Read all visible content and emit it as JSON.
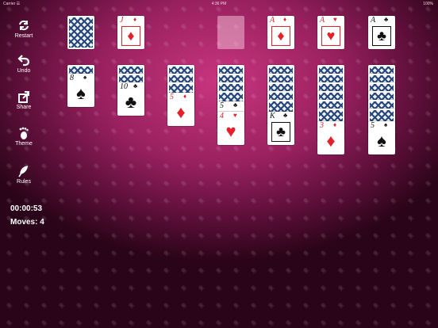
{
  "status": {
    "carrier": "Carrier ☰",
    "time": "4:36 PM",
    "battery": "100%"
  },
  "sidebar": {
    "restart": "Restart",
    "undo": "Undo",
    "share": "Share",
    "theme": "Theme",
    "rules": "Rules"
  },
  "game": {
    "timer": "00:00:53",
    "moves": "Moves: 4"
  },
  "cards": {
    "waste": {
      "rank": "J",
      "suit": "♦",
      "color": "red"
    },
    "foundation1": {
      "rank": "A",
      "suit": "♦",
      "color": "red"
    },
    "foundation2": {
      "rank": "A",
      "suit": "♥",
      "color": "red"
    },
    "foundation3": {
      "rank": "A",
      "suit": "♣",
      "color": "black"
    },
    "t1": {
      "rank": "8",
      "suit": "♠",
      "color": "black"
    },
    "t2": {
      "rank": "10",
      "suit": "♣",
      "color": "black"
    },
    "t3": {
      "rank": "5",
      "suit": "♦",
      "color": "red"
    },
    "t4a": {
      "rank": "5",
      "suit": "♣",
      "color": "black"
    },
    "t4b": {
      "rank": "4",
      "suit": "♥",
      "color": "red"
    },
    "t5": {
      "rank": "K",
      "suit": "♣",
      "color": "black"
    },
    "t6": {
      "rank": "3",
      "suit": "♦",
      "color": "red"
    },
    "t7": {
      "rank": "5",
      "suit": "♠",
      "color": "black"
    }
  },
  "colors": {
    "red_suit": "#e4202b",
    "card_back": "#27467c",
    "background": "#9a2160"
  }
}
